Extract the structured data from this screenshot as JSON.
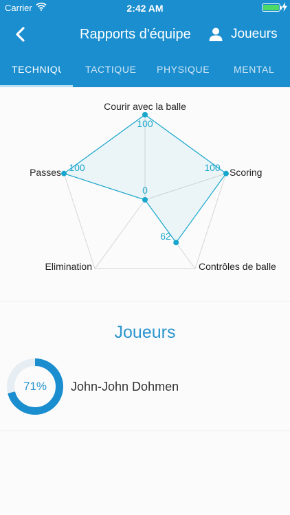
{
  "status_bar": {
    "carrier": "Carrier",
    "time": "2:42 AM",
    "battery_level": 1.0,
    "battery_color": "#4cd964"
  },
  "header": {
    "back_icon": "chevron-left-icon",
    "title": "Rapports d'équipe",
    "players_icon": "person-icon",
    "players_label": "Joueurs",
    "color": "#1a8ecf"
  },
  "tabs": [
    {
      "label": "TECHNIQUE",
      "active": true
    },
    {
      "label": "TACTIQUE",
      "active": false
    },
    {
      "label": "PHYSIQUE",
      "active": false
    },
    {
      "label": "MENTAL",
      "active": false
    }
  ],
  "chart_data": {
    "type": "radar",
    "max": 100,
    "axes": [
      "Courir avec la balle",
      "Scoring",
      "Contrôles de balle",
      "Elimination",
      "Passes"
    ],
    "values": [
      100,
      100,
      62,
      0,
      100
    ],
    "value_labels": [
      "100",
      "100",
      "62",
      "",
      "100"
    ],
    "center_label": "0",
    "color": "#19a6cc"
  },
  "players_section": {
    "title": "Joueurs",
    "players": [
      {
        "name": "John-John Dohmen",
        "percent_label": "71%",
        "percent": 71
      }
    ],
    "accent": "#1a8ecf"
  }
}
